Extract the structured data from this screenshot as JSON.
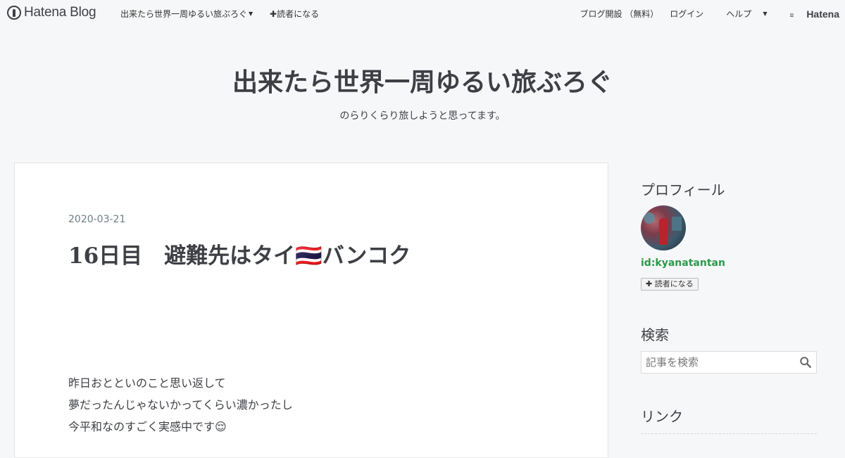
{
  "navbar": {
    "brand": "Hatena Blog",
    "blog_menu": "出来たら世界一周ゆるい旅ぶろぐ",
    "subscribe": "読者になる",
    "open_blog": "ブログ開設 （無料）",
    "login": "ログイン",
    "help": "ヘルプ",
    "hatena": "Hatena"
  },
  "header": {
    "title": "出来たら世界一周ゆるい旅ぶろぐ",
    "description": "のらりくらり旅しようと思ってます。"
  },
  "entry": {
    "date": "2020-03-21",
    "title": "16日目　避難先はタイ🇹🇭バンコク",
    "body": [
      "昨日おとといのこと思い返して",
      "夢だったんじゃないかってくらい濃かったし",
      "今平和なのすごく実感中です😌"
    ]
  },
  "sidebar": {
    "profile_heading": "プロフィール",
    "user_id": "id:kyanatantan",
    "subscribe_button": "読者になる",
    "search_heading": "検索",
    "search_placeholder": "記事を検索",
    "links_heading": "リンク"
  },
  "colors": {
    "background": "#f6f7f8",
    "text": "#3d3f44",
    "user_id": "#2a9a4b",
    "date": "#6b7d86"
  }
}
